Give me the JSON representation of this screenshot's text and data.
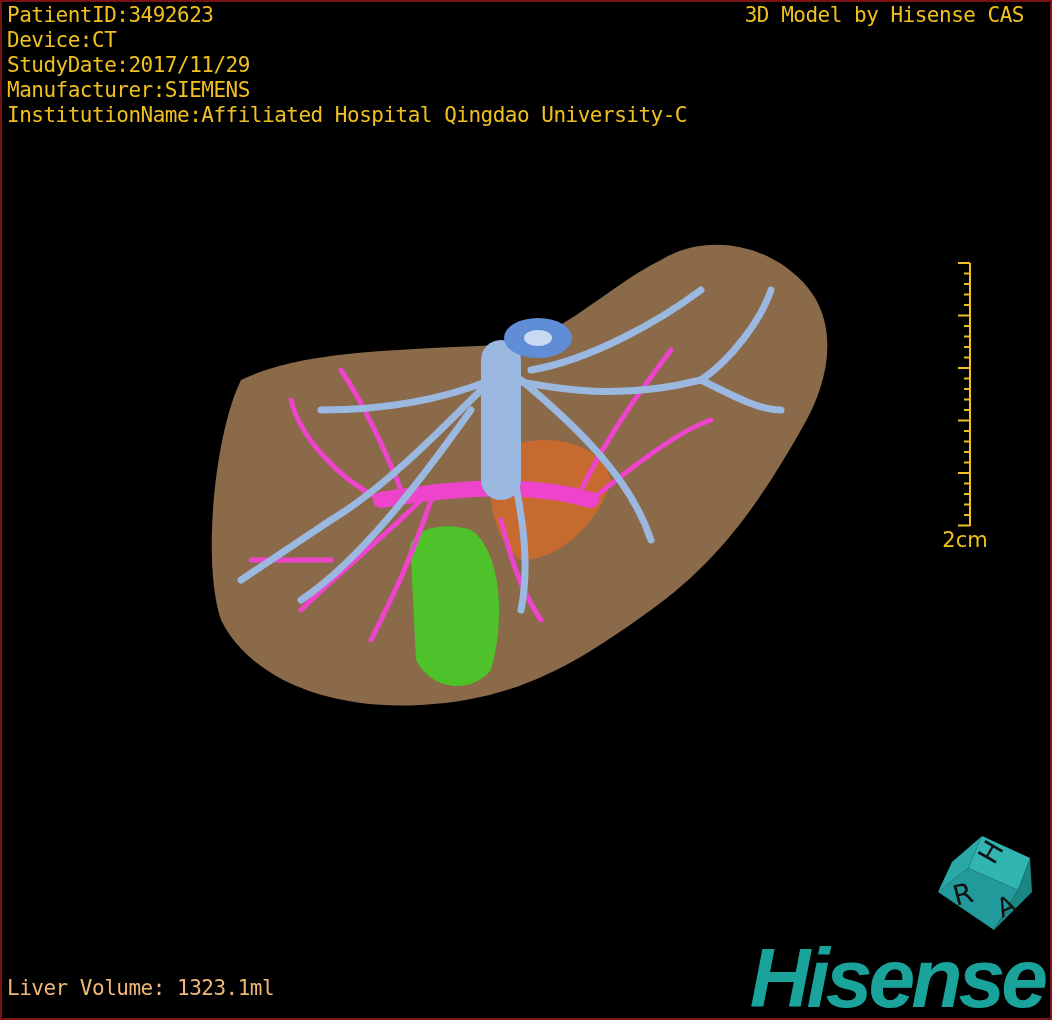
{
  "study_info": [
    "PatientID:3492623",
    "Device:CT",
    "StudyDate:2017/11/29",
    "Manufacturer:SIEMENS",
    "InstitutionName:Affiliated Hospital Qingdao University-C"
  ],
  "viewer_title": "3D Model by Hisense CAS",
  "scale_bar": {
    "label": "2cm"
  },
  "orientation_cube": {
    "labels": [
      "H",
      "R",
      "A"
    ]
  },
  "liver_volume": "Liver Volume: 1323.1ml",
  "logo": "Hisense"
}
